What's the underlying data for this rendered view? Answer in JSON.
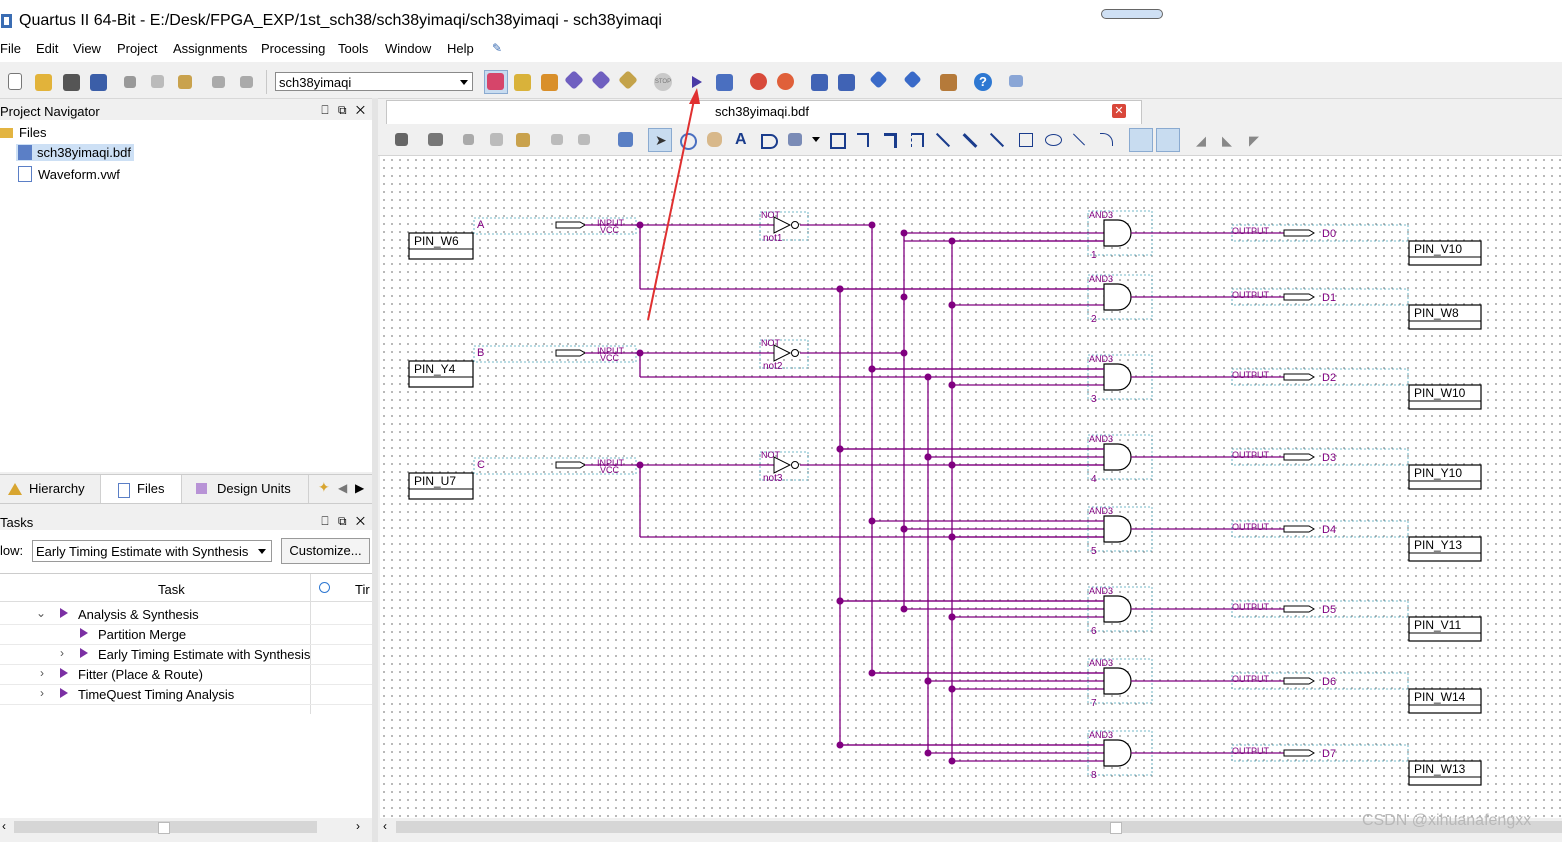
{
  "window": {
    "title": "Quartus II 64-Bit - E:/Desk/FPGA_EXP/1st_sch38/sch38yimaqi/sch38yimaqi - sch38yimaqi"
  },
  "menu": [
    "File",
    "Edit",
    "View",
    "Project",
    "Assignments",
    "Processing",
    "Tools",
    "Window",
    "Help"
  ],
  "toolbar": {
    "entity": "sch38yimaqi"
  },
  "project_navigator": {
    "title": "Project Navigator",
    "controls": "⎕ ⧉ ✕",
    "root": "Files",
    "files": [
      "sch38yimaqi.bdf",
      "Waveform.vwf"
    ],
    "tabs": [
      "Hierarchy",
      "Files",
      "Design Units"
    ]
  },
  "tasks": {
    "title": "Tasks",
    "flow_label": "low:",
    "flow_value": "Early Timing Estimate with Synthesis",
    "customize": "Customize...",
    "col_task": "Task",
    "col_time": "Tir",
    "rows": [
      "Analysis & Synthesis",
      "Partition Merge",
      "Early Timing Estimate with Synthesis",
      "Fitter (Place & Route)",
      "TimeQuest Timing Analysis"
    ]
  },
  "editor": {
    "tab": "sch38yimaqi.bdf",
    "inputs": [
      {
        "name": "A",
        "pin": "PIN_W6",
        "not": "not1"
      },
      {
        "name": "B",
        "pin": "PIN_Y4",
        "not": "not2"
      },
      {
        "name": "C",
        "pin": "PIN_U7",
        "not": "not3"
      }
    ],
    "input_type": "INPUT",
    "vcc": "VCC",
    "not_type": "NOT",
    "gate_type": "AND3",
    "output_type": "OUTPUT",
    "gates": [
      "1",
      "2",
      "3",
      "4",
      "5",
      "6",
      "7",
      "8"
    ],
    "outputs": [
      "D0",
      "D1",
      "D2",
      "D3",
      "D4",
      "D5",
      "D6",
      "D7"
    ],
    "output_pins": [
      "PIN_V10",
      "PIN_W8",
      "PIN_W10",
      "PIN_Y10",
      "PIN_Y13",
      "PIN_V11",
      "PIN_W14",
      "PIN_W13"
    ]
  },
  "watermark": "CSDN @xihuanafengxx",
  "colors": {
    "wire": "#800080",
    "annotation_arrow": "#e03030",
    "selection": "#c8dcf0"
  }
}
